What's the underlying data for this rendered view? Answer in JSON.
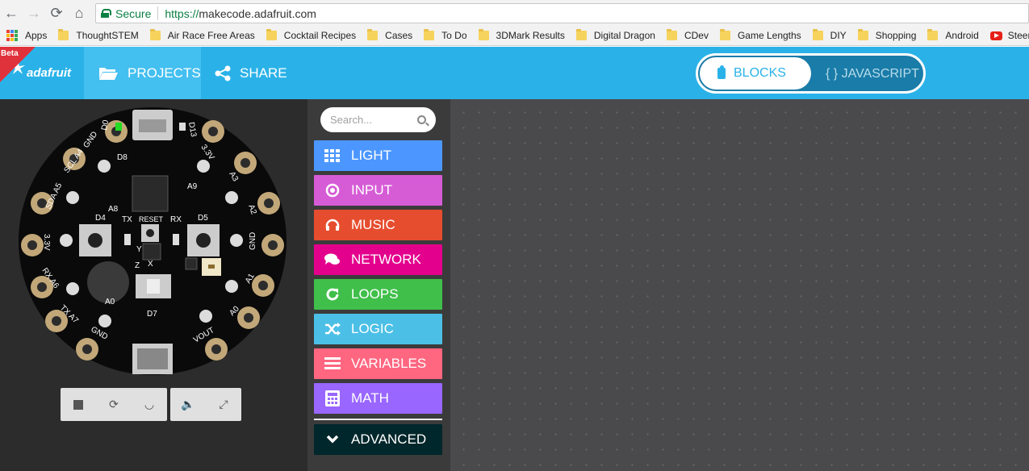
{
  "browser": {
    "secure_label": "Secure",
    "url_proto": "https://",
    "url_rest": "makecode.adafruit.com",
    "bookmarks": [
      "Apps",
      "ThoughtSTEM",
      "Air Race Free Areas",
      "Cocktail Recipes",
      "Cases",
      "To Do",
      "3DMark Results",
      "Digital Dragon",
      "CDev",
      "Game Lengths",
      "DIY",
      "Shopping",
      "Android",
      "Steerner"
    ]
  },
  "header": {
    "beta": "Beta",
    "logo": "adafruit",
    "projects": "PROJECTS",
    "share": "SHARE",
    "blocks": "BLOCKS",
    "javascript": "{ } JAVASCRIPT"
  },
  "board": {
    "top_left": "D0",
    "top_right": "D13",
    "pads": [
      "GND",
      "SCL A4",
      "SDA A5",
      "3.3V",
      "RX A6",
      "TX A7",
      "GND",
      "3.3V",
      "A3",
      "A2",
      "GND",
      "A1",
      "A0",
      "VOUT"
    ],
    "labels": {
      "d8": "D8",
      "a9": "A9",
      "a8": "A8",
      "d4": "D4",
      "d5": "D5",
      "tx": "TX",
      "rx": "RX",
      "reset": "RESET",
      "a0": "A0",
      "d7": "D7",
      "y": "Y",
      "x": "X",
      "z": "Z"
    }
  },
  "toolbox": {
    "search_placeholder": "Search...",
    "categories": [
      {
        "label": "LIGHT",
        "color": "#4c97ff",
        "icon": "grid-icon"
      },
      {
        "label": "INPUT",
        "color": "#d65cd6",
        "icon": "target-icon"
      },
      {
        "label": "MUSIC",
        "color": "#e64d2f",
        "icon": "headphones-icon"
      },
      {
        "label": "NETWORK",
        "color": "#e3008c",
        "icon": "chat-icon"
      },
      {
        "label": "LOOPS",
        "color": "#40bf4a",
        "icon": "refresh-icon"
      },
      {
        "label": "LOGIC",
        "color": "#4cbfe6",
        "icon": "shuffle-icon"
      },
      {
        "label": "VARIABLES",
        "color": "#ff6680",
        "icon": "list-icon"
      },
      {
        "label": "MATH",
        "color": "#9966ff",
        "icon": "calculator-icon"
      },
      {
        "label": "ADVANCED",
        "color": "#00272b",
        "icon": "chevron-down-icon"
      }
    ]
  }
}
